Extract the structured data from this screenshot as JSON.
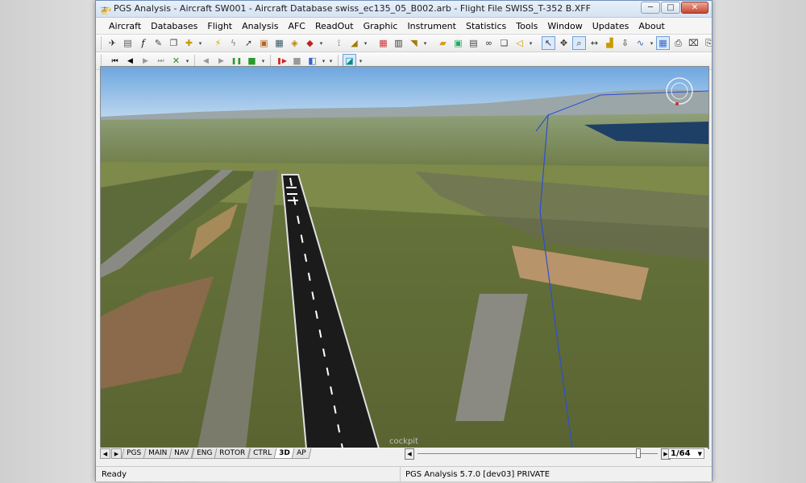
{
  "window": {
    "title": "PGS Analysis - Aircraft SW001 - Aircraft Database swiss_ec135_05_B002.arb - Flight File SWISS_T-352 B.XFF",
    "minimize": "─",
    "maximize": "□",
    "close": "✕"
  },
  "menu": [
    "Aircraft",
    "Databases",
    "Flight",
    "Analysis",
    "AFC",
    "ReadOut",
    "Graphic",
    "Instrument",
    "Statistics",
    "Tools",
    "Window",
    "Updates",
    "About"
  ],
  "toolbar1_icons": [
    "aircraft-icon",
    "database-icon",
    "function-icon",
    "edit-icon",
    "copy-icon",
    "crosshair-icon",
    "lightning-icon",
    "lightning-alt-icon",
    "cursor-icon",
    "stamp-icon",
    "report-icon",
    "search-doc-icon",
    "car-icon",
    "readout-icon",
    "tag-icon",
    "grid-icon",
    "grid-alt-icon",
    "tag-alt-icon",
    "folder-open-icon",
    "window-icon",
    "tile-icon",
    "binoculars-icon",
    "copy-window-icon",
    "speaker-icon",
    "pointer-icon",
    "move-icon",
    "zoom-icon",
    "fit-width-icon",
    "bar-chart-icon",
    "down-arrow-icon",
    "line-chart-icon",
    "grid-toggle-icon",
    "print-icon",
    "print-preview-icon",
    "export-icon",
    "dice-icon",
    "camera-icon",
    "info-icon"
  ],
  "playback": {
    "first": "⏮",
    "prev": "◀",
    "play": "▶",
    "last": "⏭",
    "stop_x": "✕",
    "rewind": "◀",
    "forward": "▶",
    "pause": "❚❚",
    "stop": "■",
    "record_pause": "❚▶",
    "record_stop": "■"
  },
  "tabs": [
    "PGS",
    "MAIN",
    "NAV",
    "ENG",
    "ROTOR",
    "CTRL",
    "3D",
    "AP"
  ],
  "active_tab": "3D",
  "viewport": {
    "label": "cockpit"
  },
  "timeline": {
    "position_fraction": 0.92,
    "zoom": "1/64"
  },
  "status": {
    "left": "Ready",
    "right": "PGS Analysis 5.7.0 [dev03] PRIVATE"
  },
  "colors": {
    "sky_top": "#7fb3e3",
    "sky_bottom": "#b8d4ee",
    "grass": "#6f7a3c",
    "runway": "#1b1b1b",
    "flight_path": "#2a4fd6"
  }
}
